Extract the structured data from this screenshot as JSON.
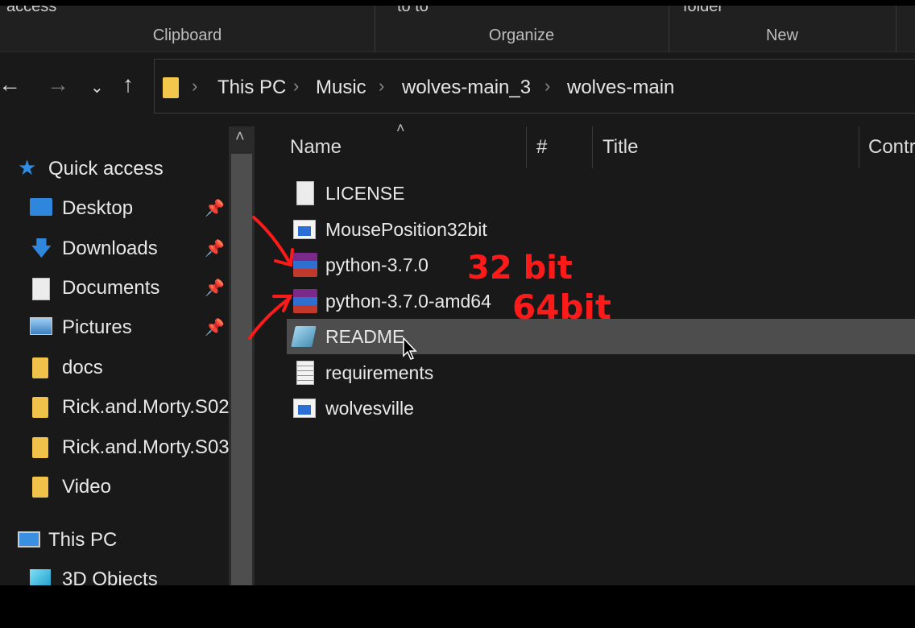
{
  "ribbon": {
    "groups": [
      {
        "label": "Clipboard",
        "cut_text": "access"
      },
      {
        "label": "Organize",
        "cut_text": "to          to"
      },
      {
        "label": "New",
        "cut_text": "folder"
      }
    ]
  },
  "address": {
    "breadcrumbs": [
      "This PC",
      "Music",
      "wolves-main_3",
      "wolves-main"
    ]
  },
  "nav": {
    "quick_access": "Quick access",
    "items": [
      "Desktop",
      "Downloads",
      "Documents",
      "Pictures",
      "docs",
      "Rick.and.Morty.S02",
      "Rick.and.Morty.S03",
      "Video"
    ],
    "this_pc": "This PC",
    "objects": "3D Objects"
  },
  "columns": {
    "name": "Name",
    "number": "#",
    "title": "Title",
    "contributing": "Contr"
  },
  "files": [
    {
      "name": "LICENSE",
      "icon": "document-icon"
    },
    {
      "name": "MousePosition32bit",
      "icon": "application-icon"
    },
    {
      "name": "python-3.7.0",
      "icon": "winrar-archive-icon"
    },
    {
      "name": "python-3.7.0-amd64",
      "icon": "winrar-archive-icon"
    },
    {
      "name": "README",
      "icon": "markdown-file-icon",
      "selected": true
    },
    {
      "name": "requirements",
      "icon": "text-file-icon"
    },
    {
      "name": "wolvesville",
      "icon": "application-icon"
    }
  ],
  "annotations": {
    "first": "32 bit",
    "second": "64bit",
    "color": "#ff1a1a"
  },
  "colors": {
    "background": "#191919",
    "selection": "#4d4d4d",
    "folder": "#f0c24a"
  }
}
